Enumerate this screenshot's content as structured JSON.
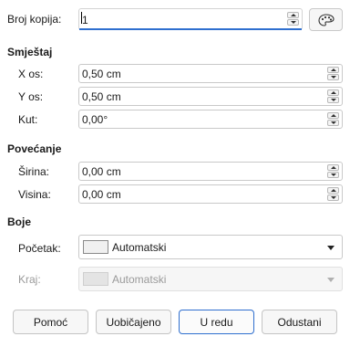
{
  "copies": {
    "label": "Broj kopija:",
    "value": "1",
    "palette_icon": "color-palette-icon"
  },
  "placement": {
    "heading": "Smještaj",
    "x_label": "X os:",
    "x_value": "0,50 cm",
    "y_label": "Y os:",
    "y_value": "0,50 cm",
    "angle_label": "Kut:",
    "angle_value": "0,00°"
  },
  "enlargement": {
    "heading": "Povećanje",
    "width_label": "Širina:",
    "width_value": "0,00 cm",
    "height_label": "Visina:",
    "height_value": "0,00 cm"
  },
  "colors": {
    "heading": "Boje",
    "start_label": "Početak:",
    "start_value": "Automatski",
    "end_label": "Kraj:",
    "end_value": "Automatski"
  },
  "buttons": {
    "help": "Pomoć",
    "reset": "Uobičajeno",
    "ok": "U redu",
    "cancel": "Odustani"
  },
  "accent_color": "#2f6fcf"
}
